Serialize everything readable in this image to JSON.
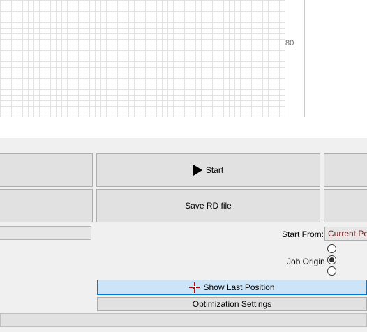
{
  "canvas": {
    "ruler_label": "80"
  },
  "buttons": {
    "start_label": "Start",
    "save_rd_label": "Save RD file"
  },
  "start_from": {
    "label": "Start From:",
    "value": "Current Pos"
  },
  "job_origin": {
    "label": "Job Origin",
    "options_checked": [
      false,
      true,
      false
    ]
  },
  "show_last_position_label": "Show Last Position",
  "optimization_settings_label": "Optimization Settings",
  "colors": {
    "highlight_bg": "#cce4f7",
    "highlight_border": "#0078d7",
    "select_text": "#7a1e1e",
    "crosshair": "#cc0000"
  }
}
